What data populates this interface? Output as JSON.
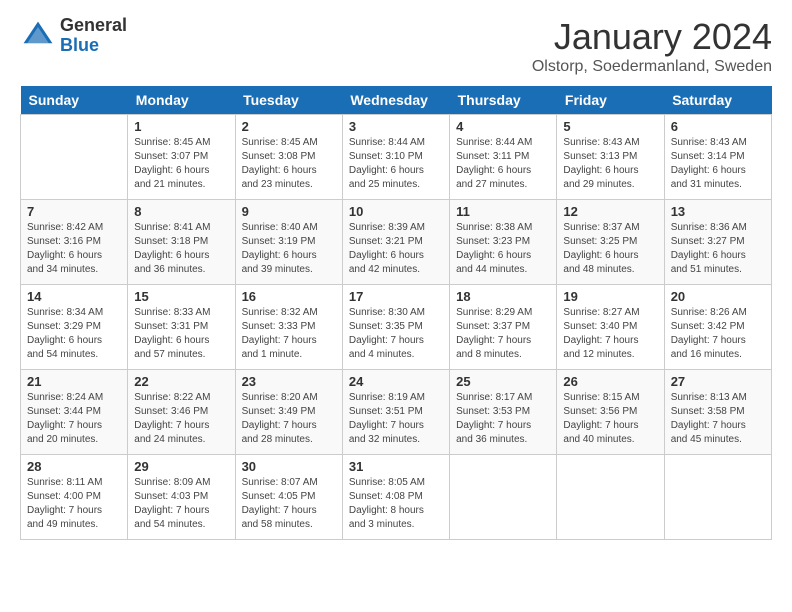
{
  "header": {
    "logo_general": "General",
    "logo_blue": "Blue",
    "month_title": "January 2024",
    "location": "Olstorp, Soedermanland, Sweden"
  },
  "days_of_week": [
    "Sunday",
    "Monday",
    "Tuesday",
    "Wednesday",
    "Thursday",
    "Friday",
    "Saturday"
  ],
  "weeks": [
    [
      {
        "day": "",
        "info": ""
      },
      {
        "day": "1",
        "info": "Sunrise: 8:45 AM\nSunset: 3:07 PM\nDaylight: 6 hours\nand 21 minutes."
      },
      {
        "day": "2",
        "info": "Sunrise: 8:45 AM\nSunset: 3:08 PM\nDaylight: 6 hours\nand 23 minutes."
      },
      {
        "day": "3",
        "info": "Sunrise: 8:44 AM\nSunset: 3:10 PM\nDaylight: 6 hours\nand 25 minutes."
      },
      {
        "day": "4",
        "info": "Sunrise: 8:44 AM\nSunset: 3:11 PM\nDaylight: 6 hours\nand 27 minutes."
      },
      {
        "day": "5",
        "info": "Sunrise: 8:43 AM\nSunset: 3:13 PM\nDaylight: 6 hours\nand 29 minutes."
      },
      {
        "day": "6",
        "info": "Sunrise: 8:43 AM\nSunset: 3:14 PM\nDaylight: 6 hours\nand 31 minutes."
      }
    ],
    [
      {
        "day": "7",
        "info": "Sunrise: 8:42 AM\nSunset: 3:16 PM\nDaylight: 6 hours\nand 34 minutes."
      },
      {
        "day": "8",
        "info": "Sunrise: 8:41 AM\nSunset: 3:18 PM\nDaylight: 6 hours\nand 36 minutes."
      },
      {
        "day": "9",
        "info": "Sunrise: 8:40 AM\nSunset: 3:19 PM\nDaylight: 6 hours\nand 39 minutes."
      },
      {
        "day": "10",
        "info": "Sunrise: 8:39 AM\nSunset: 3:21 PM\nDaylight: 6 hours\nand 42 minutes."
      },
      {
        "day": "11",
        "info": "Sunrise: 8:38 AM\nSunset: 3:23 PM\nDaylight: 6 hours\nand 44 minutes."
      },
      {
        "day": "12",
        "info": "Sunrise: 8:37 AM\nSunset: 3:25 PM\nDaylight: 6 hours\nand 48 minutes."
      },
      {
        "day": "13",
        "info": "Sunrise: 8:36 AM\nSunset: 3:27 PM\nDaylight: 6 hours\nand 51 minutes."
      }
    ],
    [
      {
        "day": "14",
        "info": "Sunrise: 8:34 AM\nSunset: 3:29 PM\nDaylight: 6 hours\nand 54 minutes."
      },
      {
        "day": "15",
        "info": "Sunrise: 8:33 AM\nSunset: 3:31 PM\nDaylight: 6 hours\nand 57 minutes."
      },
      {
        "day": "16",
        "info": "Sunrise: 8:32 AM\nSunset: 3:33 PM\nDaylight: 7 hours\nand 1 minute."
      },
      {
        "day": "17",
        "info": "Sunrise: 8:30 AM\nSunset: 3:35 PM\nDaylight: 7 hours\nand 4 minutes."
      },
      {
        "day": "18",
        "info": "Sunrise: 8:29 AM\nSunset: 3:37 PM\nDaylight: 7 hours\nand 8 minutes."
      },
      {
        "day": "19",
        "info": "Sunrise: 8:27 AM\nSunset: 3:40 PM\nDaylight: 7 hours\nand 12 minutes."
      },
      {
        "day": "20",
        "info": "Sunrise: 8:26 AM\nSunset: 3:42 PM\nDaylight: 7 hours\nand 16 minutes."
      }
    ],
    [
      {
        "day": "21",
        "info": "Sunrise: 8:24 AM\nSunset: 3:44 PM\nDaylight: 7 hours\nand 20 minutes."
      },
      {
        "day": "22",
        "info": "Sunrise: 8:22 AM\nSunset: 3:46 PM\nDaylight: 7 hours\nand 24 minutes."
      },
      {
        "day": "23",
        "info": "Sunrise: 8:20 AM\nSunset: 3:49 PM\nDaylight: 7 hours\nand 28 minutes."
      },
      {
        "day": "24",
        "info": "Sunrise: 8:19 AM\nSunset: 3:51 PM\nDaylight: 7 hours\nand 32 minutes."
      },
      {
        "day": "25",
        "info": "Sunrise: 8:17 AM\nSunset: 3:53 PM\nDaylight: 7 hours\nand 36 minutes."
      },
      {
        "day": "26",
        "info": "Sunrise: 8:15 AM\nSunset: 3:56 PM\nDaylight: 7 hours\nand 40 minutes."
      },
      {
        "day": "27",
        "info": "Sunrise: 8:13 AM\nSunset: 3:58 PM\nDaylight: 7 hours\nand 45 minutes."
      }
    ],
    [
      {
        "day": "28",
        "info": "Sunrise: 8:11 AM\nSunset: 4:00 PM\nDaylight: 7 hours\nand 49 minutes."
      },
      {
        "day": "29",
        "info": "Sunrise: 8:09 AM\nSunset: 4:03 PM\nDaylight: 7 hours\nand 54 minutes."
      },
      {
        "day": "30",
        "info": "Sunrise: 8:07 AM\nSunset: 4:05 PM\nDaylight: 7 hours\nand 58 minutes."
      },
      {
        "day": "31",
        "info": "Sunrise: 8:05 AM\nSunset: 4:08 PM\nDaylight: 8 hours\nand 3 minutes."
      },
      {
        "day": "",
        "info": ""
      },
      {
        "day": "",
        "info": ""
      },
      {
        "day": "",
        "info": ""
      }
    ]
  ]
}
